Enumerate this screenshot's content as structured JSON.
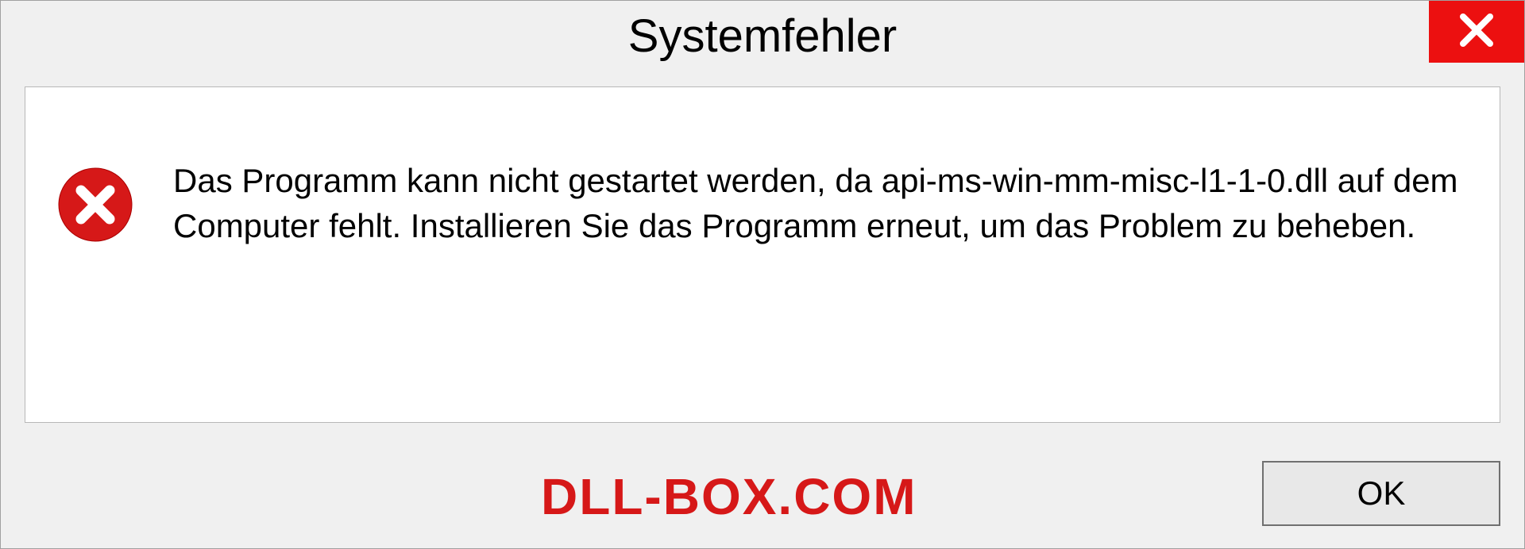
{
  "dialog": {
    "title": "Systemfehler",
    "message": "Das Programm kann nicht gestartet werden, da api-ms-win-mm-misc-l1-1-0.dll auf dem Computer fehlt. Installieren Sie das Programm erneut, um das Problem zu beheben.",
    "ok_label": "OK"
  },
  "watermark": "DLL-BOX.COM",
  "colors": {
    "close_bg": "#ec1010",
    "error_red": "#d61818",
    "watermark_red": "#d61818"
  }
}
